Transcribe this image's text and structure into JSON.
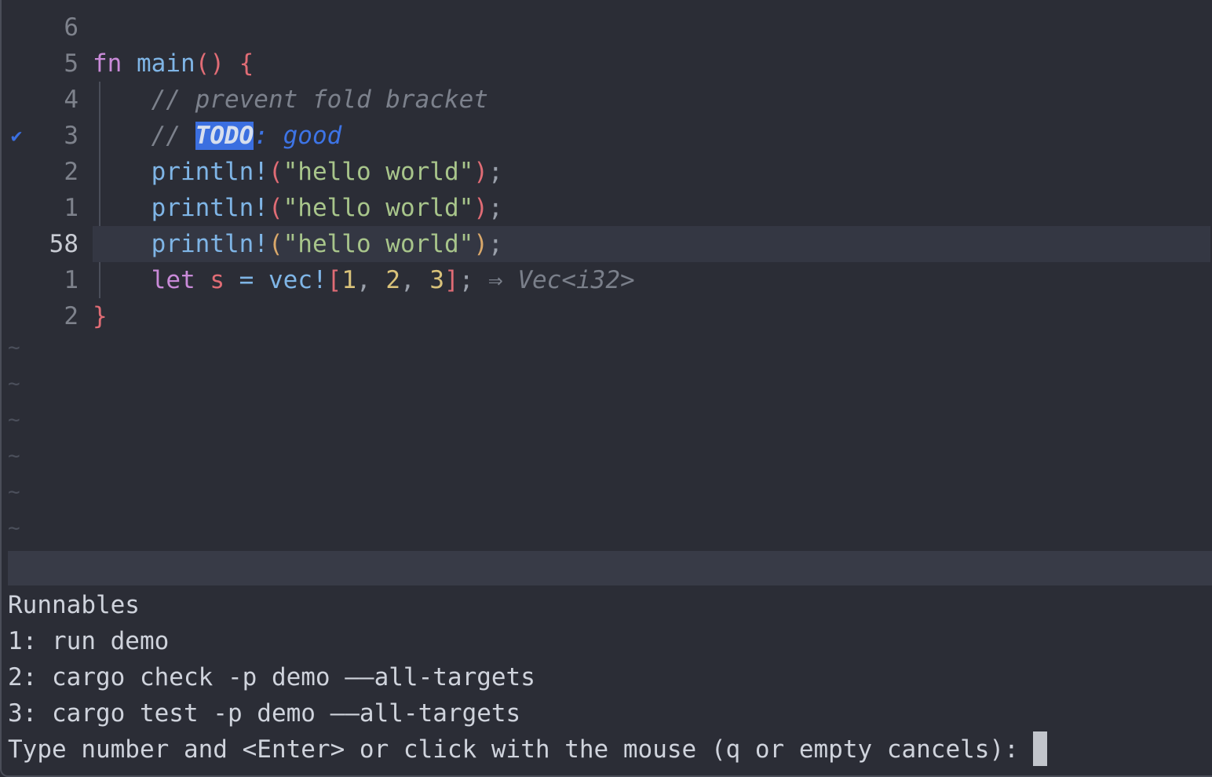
{
  "editor": {
    "lines": [
      {
        "num": "6",
        "sign": "",
        "current": false,
        "tokens": []
      },
      {
        "num": "5",
        "sign": "",
        "current": false,
        "tokens": [
          {
            "t": "fn",
            "c": "kw"
          },
          {
            "t": " ",
            "c": ""
          },
          {
            "t": "main",
            "c": "fn"
          },
          {
            "t": "()",
            "c": "br"
          },
          {
            "t": " ",
            "c": ""
          },
          {
            "t": "{",
            "c": "br"
          }
        ]
      },
      {
        "num": "4",
        "sign": "",
        "current": false,
        "tokens": [
          {
            "t": "    ",
            "c": ""
          },
          {
            "t": "// prevent fold bracket",
            "c": "cmt"
          }
        ]
      },
      {
        "num": "3",
        "sign": "✔",
        "current": false,
        "tokens": [
          {
            "t": "    ",
            "c": ""
          },
          {
            "t": "// ",
            "c": "cmt"
          },
          {
            "t": "TODO",
            "c": "todo-kw"
          },
          {
            "t": ": good",
            "c": "todo-rest"
          }
        ]
      },
      {
        "num": "2",
        "sign": "",
        "current": false,
        "tokens": [
          {
            "t": "    ",
            "c": ""
          },
          {
            "t": "println!",
            "c": "fn"
          },
          {
            "t": "(",
            "c": "br"
          },
          {
            "t": "\"hello world\"",
            "c": "str"
          },
          {
            "t": ")",
            "c": "br"
          },
          {
            "t": ";",
            "c": "punc"
          }
        ]
      },
      {
        "num": "1",
        "sign": "",
        "current": false,
        "tokens": [
          {
            "t": "    ",
            "c": ""
          },
          {
            "t": "println!",
            "c": "fn"
          },
          {
            "t": "(",
            "c": "br"
          },
          {
            "t": "\"hello world\"",
            "c": "str"
          },
          {
            "t": ")",
            "c": "br"
          },
          {
            "t": ";",
            "c": "punc"
          }
        ]
      },
      {
        "num": "58",
        "sign": "",
        "current": true,
        "tokens": [
          {
            "t": "    ",
            "c": ""
          },
          {
            "t": "println!",
            "c": "fn"
          },
          {
            "t": "(",
            "c": "br2"
          },
          {
            "t": "\"hello world\"",
            "c": "str"
          },
          {
            "t": ")",
            "c": "br2"
          },
          {
            "t": ";",
            "c": "punc"
          }
        ]
      },
      {
        "num": "1",
        "sign": "",
        "current": false,
        "tokens": [
          {
            "t": "    ",
            "c": ""
          },
          {
            "t": "let",
            "c": "kw"
          },
          {
            "t": " ",
            "c": ""
          },
          {
            "t": "s",
            "c": "var"
          },
          {
            "t": " ",
            "c": ""
          },
          {
            "t": "=",
            "c": "fn"
          },
          {
            "t": " ",
            "c": ""
          },
          {
            "t": "vec!",
            "c": "fn"
          },
          {
            "t": "[",
            "c": "br"
          },
          {
            "t": "1",
            "c": "num"
          },
          {
            "t": ", ",
            "c": "punc"
          },
          {
            "t": "2",
            "c": "num"
          },
          {
            "t": ", ",
            "c": "punc"
          },
          {
            "t": "3",
            "c": "num"
          },
          {
            "t": "]",
            "c": "br"
          },
          {
            "t": ";",
            "c": "punc"
          },
          {
            "t": " ⇒ Vec<i32>",
            "c": "hint"
          }
        ]
      },
      {
        "num": "2",
        "sign": "",
        "current": false,
        "tokens": [
          {
            "t": "}",
            "c": "br"
          }
        ]
      }
    ],
    "tilde_glyph": "~",
    "tilde_count": 6
  },
  "prompt": {
    "title": "Runnables",
    "options": [
      "1: run demo",
      "2: cargo check -p demo ——all-targets",
      "3: cargo test -p demo ——all-targets"
    ],
    "input_prompt": "Type number and <Enter> or click with the mouse (q or empty cancels):"
  }
}
